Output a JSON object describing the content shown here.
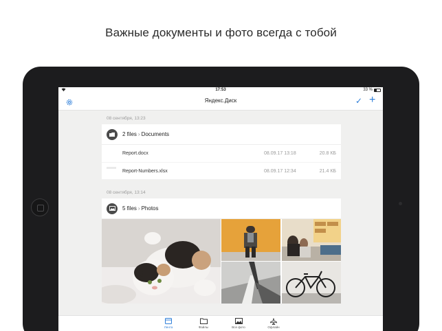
{
  "headline": "Важные документы и фото всегда с тобой",
  "status": {
    "time": "17:53",
    "battery": "33 %"
  },
  "nav": {
    "title": "Яндекс.Диск"
  },
  "groups": [
    {
      "date": "08 сентября, 13:23",
      "count": "2 files",
      "folder": "Documents",
      "files": [
        {
          "name": "Report.docx",
          "date": "08.09.17 13:18",
          "size": "20.8 КБ"
        },
        {
          "name": "Report-Numbers.xlsx",
          "date": "08.09.17 12:34",
          "size": "21.4 КБ"
        }
      ]
    },
    {
      "date": "08 сентября, 13:14",
      "count": "5 files",
      "folder": "Photos"
    }
  ],
  "tabs": [
    {
      "label": "Лента",
      "icon": "feed-icon"
    },
    {
      "label": "Файлы",
      "icon": "folder-icon"
    },
    {
      "label": "Все фото",
      "icon": "photo-icon"
    },
    {
      "label": "Офлайн",
      "icon": "airplane-icon"
    }
  ],
  "colors": {
    "accent": "#2f7fd9",
    "device": "#1c1c1e"
  }
}
